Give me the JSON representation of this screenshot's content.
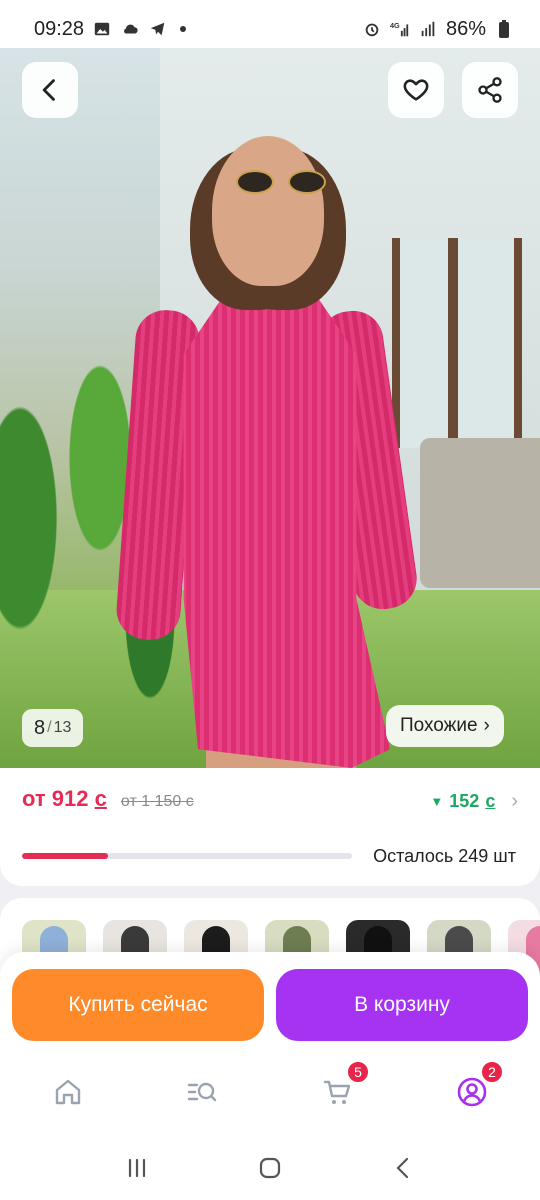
{
  "status_bar": {
    "time": "09:28",
    "network": "4G+",
    "battery": "86%"
  },
  "header": {
    "back_icon": "arrow-left-icon",
    "favorite_icon": "heart-icon",
    "share_icon": "share-icon"
  },
  "gallery": {
    "current": "8",
    "separator": "/",
    "total": "13",
    "similar_label": "Похожие",
    "similar_chevron": "›"
  },
  "price": {
    "prefix": "от",
    "current_amount": "912",
    "currency": "с",
    "old": "от 1 150 с",
    "bonus_arrow": "▼",
    "bonus_amount": "152",
    "bonus_currency": "с",
    "bonus_chevron": "›"
  },
  "stock": {
    "remaining_text": "Осталось 249 шт",
    "fill_fraction": 0.26
  },
  "thumbnails": [
    {
      "bg": "#dfe3c7",
      "fg": "#8fb0d8"
    },
    {
      "bg": "#e8e4df",
      "fg": "#3a3a3a"
    },
    {
      "bg": "#ece7e0",
      "fg": "#1c1c1c"
    },
    {
      "bg": "#d8ddc1",
      "fg": "#6f7d52"
    },
    {
      "bg": "#2a2a2a",
      "fg": "#111111"
    },
    {
      "bg": "#d4d9c6",
      "fg": "#4b4b4b"
    },
    {
      "bg": "#f3dde3",
      "fg": "#e77aa1"
    }
  ],
  "actions": {
    "buy_now": "Купить сейчас",
    "add_to_cart": "В корзину"
  },
  "bottom_nav": {
    "cart_badge": "5",
    "profile_badge": "2"
  },
  "colors": {
    "accent_red": "#e52c55",
    "bonus_green": "#1ea761",
    "buy_orange": "#ff8a2a",
    "cart_purple": "#a632f2"
  }
}
